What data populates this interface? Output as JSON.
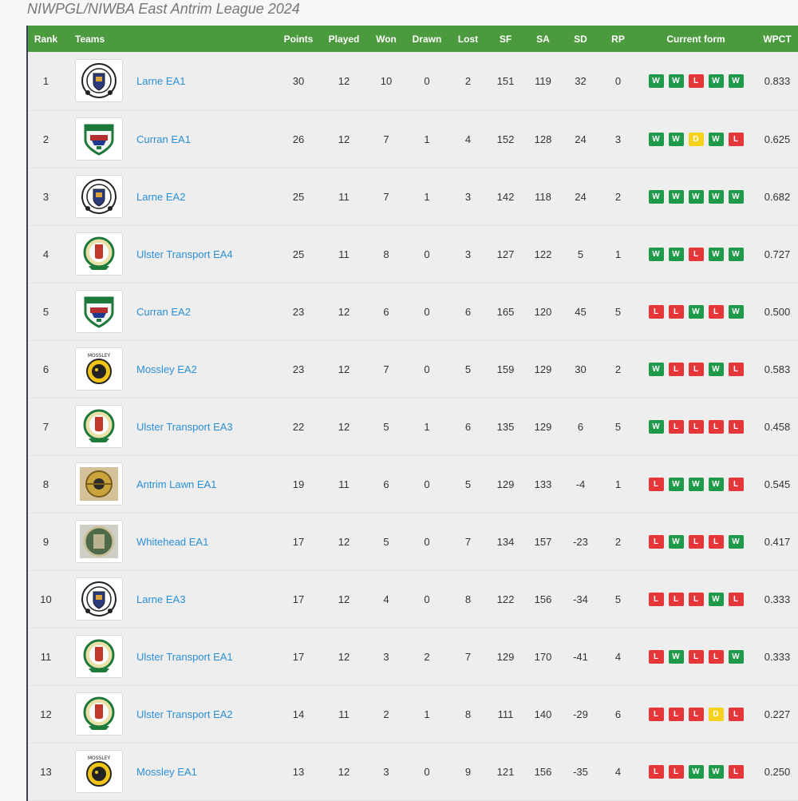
{
  "page": {
    "title": "NIWPGL/NIWBA East Antrim League 2024"
  },
  "colors": {
    "header_bg": "#4c9a3e",
    "win": "#1f9a4a",
    "loss": "#e5373a",
    "draw": "#f6d21c",
    "link": "#2a8fd6"
  },
  "table": {
    "headers": [
      "Rank",
      "Teams",
      "Points",
      "Played",
      "Won",
      "Drawn",
      "Lost",
      "SF",
      "SA",
      "SD",
      "RP",
      "Current form",
      "WPCT"
    ],
    "rows": [
      {
        "rank": "1",
        "team": "Larne EA1",
        "logo": "larne-crest-icon",
        "points": "30",
        "played": "12",
        "won": "10",
        "drawn": "0",
        "lost": "2",
        "sf": "151",
        "sa": "119",
        "sd": "32",
        "rp": "0",
        "form": [
          "W",
          "W",
          "L",
          "W",
          "W"
        ],
        "wpct": "0.833"
      },
      {
        "rank": "2",
        "team": "Curran EA1",
        "logo": "curran-crest-icon",
        "points": "26",
        "played": "12",
        "won": "7",
        "drawn": "1",
        "lost": "4",
        "sf": "152",
        "sa": "128",
        "sd": "24",
        "rp": "3",
        "form": [
          "W",
          "W",
          "D",
          "W",
          "L"
        ],
        "wpct": "0.625"
      },
      {
        "rank": "3",
        "team": "Larne EA2",
        "logo": "larne-crest-icon",
        "points": "25",
        "played": "11",
        "won": "7",
        "drawn": "1",
        "lost": "3",
        "sf": "142",
        "sa": "118",
        "sd": "24",
        "rp": "2",
        "form": [
          "W",
          "W",
          "W",
          "W",
          "W"
        ],
        "wpct": "0.682"
      },
      {
        "rank": "4",
        "team": "Ulster Transport EA4",
        "logo": "ulster-transport-crest-icon",
        "points": "25",
        "played": "11",
        "won": "8",
        "drawn": "0",
        "lost": "3",
        "sf": "127",
        "sa": "122",
        "sd": "5",
        "rp": "1",
        "form": [
          "W",
          "W",
          "L",
          "W",
          "W"
        ],
        "wpct": "0.727"
      },
      {
        "rank": "5",
        "team": "Curran EA2",
        "logo": "curran-crest-icon",
        "points": "23",
        "played": "12",
        "won": "6",
        "drawn": "0",
        "lost": "6",
        "sf": "165",
        "sa": "120",
        "sd": "45",
        "rp": "5",
        "form": [
          "L",
          "L",
          "W",
          "L",
          "W"
        ],
        "wpct": "0.500"
      },
      {
        "rank": "6",
        "team": "Mossley EA2",
        "logo": "mossley-crest-icon",
        "points": "23",
        "played": "12",
        "won": "7",
        "drawn": "0",
        "lost": "5",
        "sf": "159",
        "sa": "129",
        "sd": "30",
        "rp": "2",
        "form": [
          "W",
          "L",
          "L",
          "W",
          "L"
        ],
        "wpct": "0.583"
      },
      {
        "rank": "7",
        "team": "Ulster Transport EA3",
        "logo": "ulster-transport-crest-icon",
        "points": "22",
        "played": "12",
        "won": "5",
        "drawn": "1",
        "lost": "6",
        "sf": "135",
        "sa": "129",
        "sd": "6",
        "rp": "5",
        "form": [
          "W",
          "L",
          "L",
          "L",
          "L"
        ],
        "wpct": "0.458"
      },
      {
        "rank": "8",
        "team": "Antrim Lawn EA1",
        "logo": "antrim-lawn-crest-icon",
        "points": "19",
        "played": "11",
        "won": "6",
        "drawn": "0",
        "lost": "5",
        "sf": "129",
        "sa": "133",
        "sd": "-4",
        "rp": "1",
        "form": [
          "L",
          "W",
          "W",
          "W",
          "L"
        ],
        "wpct": "0.545"
      },
      {
        "rank": "9",
        "team": "Whitehead EA1",
        "logo": "whitehead-crest-icon",
        "points": "17",
        "played": "12",
        "won": "5",
        "drawn": "0",
        "lost": "7",
        "sf": "134",
        "sa": "157",
        "sd": "-23",
        "rp": "2",
        "form": [
          "L",
          "W",
          "L",
          "L",
          "W"
        ],
        "wpct": "0.417"
      },
      {
        "rank": "10",
        "team": "Larne EA3",
        "logo": "larne-crest-icon",
        "points": "17",
        "played": "12",
        "won": "4",
        "drawn": "0",
        "lost": "8",
        "sf": "122",
        "sa": "156",
        "sd": "-34",
        "rp": "5",
        "form": [
          "L",
          "L",
          "L",
          "W",
          "L"
        ],
        "wpct": "0.333"
      },
      {
        "rank": "11",
        "team": "Ulster Transport EA1",
        "logo": "ulster-transport-crest-icon",
        "points": "17",
        "played": "12",
        "won": "3",
        "drawn": "2",
        "lost": "7",
        "sf": "129",
        "sa": "170",
        "sd": "-41",
        "rp": "4",
        "form": [
          "L",
          "W",
          "L",
          "L",
          "W"
        ],
        "wpct": "0.333"
      },
      {
        "rank": "12",
        "team": "Ulster Transport EA2",
        "logo": "ulster-transport-crest-icon",
        "points": "14",
        "played": "11",
        "won": "2",
        "drawn": "1",
        "lost": "8",
        "sf": "111",
        "sa": "140",
        "sd": "-29",
        "rp": "6",
        "form": [
          "L",
          "L",
          "L",
          "D",
          "L"
        ],
        "wpct": "0.227"
      },
      {
        "rank": "13",
        "team": "Mossley EA1",
        "logo": "mossley-crest-icon",
        "points": "13",
        "played": "12",
        "won": "3",
        "drawn": "0",
        "lost": "9",
        "sf": "121",
        "sa": "156",
        "sd": "-35",
        "rp": "4",
        "form": [
          "L",
          "L",
          "W",
          "W",
          "L"
        ],
        "wpct": "0.250"
      }
    ]
  }
}
